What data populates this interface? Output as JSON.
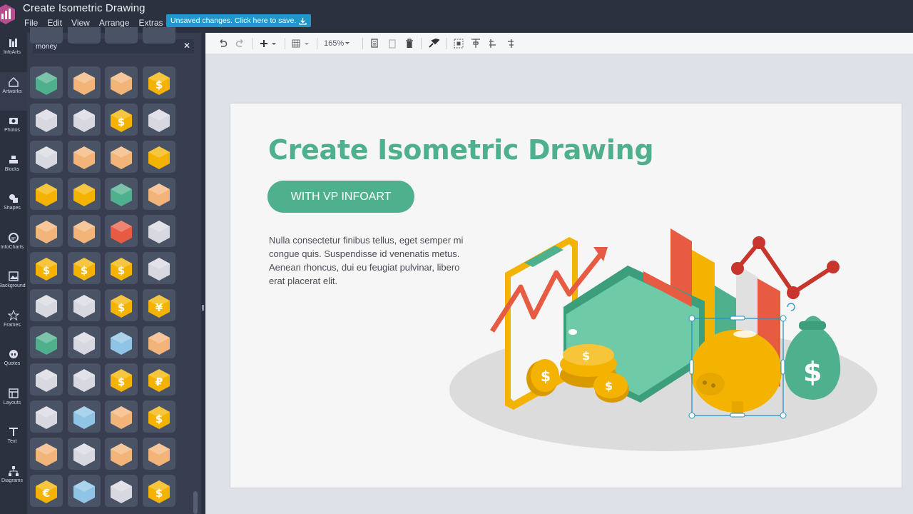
{
  "app": {
    "title": "Create Isometric Drawing",
    "menu": [
      "File",
      "Edit",
      "View",
      "Arrange",
      "Extras"
    ],
    "unsaved_label": "Unsaved changes. Click here to save."
  },
  "leftbar": {
    "tools": [
      {
        "label": "InfoArts",
        "icon": "infoarts-icon"
      },
      {
        "label": "Artworks",
        "icon": "artworks-icon"
      },
      {
        "label": "Photos",
        "icon": "camera-icon"
      },
      {
        "label": "Blocks",
        "icon": "blocks-icon"
      },
      {
        "label": "Shapes",
        "icon": "shapes-icon"
      },
      {
        "label": "InfoCharts",
        "icon": "infocharts-icon"
      },
      {
        "label": "Background",
        "icon": "background-icon"
      },
      {
        "label": "Frames",
        "icon": "frames-icon"
      },
      {
        "label": "Quotes",
        "icon": "quotes-icon"
      },
      {
        "label": "Layouts",
        "icon": "layouts-icon"
      },
      {
        "label": "Text",
        "icon": "text-icon"
      },
      {
        "label": "Diagrams",
        "icon": "diagrams-icon"
      }
    ]
  },
  "panel": {
    "search_value": "money",
    "clear_icon": "close-icon",
    "items": [
      "cash-stack",
      "pallet",
      "pallet-stack",
      "dollar-sign",
      "shelf",
      "shelf-boxes",
      "coin-stack",
      "grid-shelf",
      "rack",
      "wood-pallet",
      "pallet",
      "gold-bars",
      "gold-bricks",
      "piggy-bank",
      "wallet",
      "boxes",
      "crate",
      "box-stack",
      "credit-cards",
      "rack-long",
      "coin",
      "dollar-coin",
      "coin-pile",
      "rack-grid",
      "shelf-tall",
      "shelf-boxes",
      "coin-stack-hand",
      "yen-sign",
      "wallet-green",
      "scale-box",
      "airplane",
      "box-row",
      "cabinet",
      "scale",
      "money-bag",
      "ruble-sign",
      "tall-rack",
      "airplane",
      "box-pile",
      "coin-tower",
      "box-stack",
      "rack-boxes",
      "pallet",
      "boxes",
      "euro-sign",
      "bus",
      "shelf",
      "coin-stack"
    ]
  },
  "toolbar": {
    "zoom": "165%",
    "buttons": [
      "undo-icon",
      "redo-icon",
      "add-icon",
      "table-icon",
      "copy-icon",
      "paste-icon",
      "delete-icon",
      "format-icon",
      "select-icon",
      "align-icon",
      "distribute-icon"
    ]
  },
  "page": {
    "headline": "Create Isometric Drawing",
    "pill_label": "WITH VP INFOART",
    "body_lines": [
      "Nulla consectetur finibus tellus, eget semper mi",
      "congue quis. Suspendisse id venenatis metus.",
      "Aenean rhoncus, dui eu feugiat pulvinar, libero",
      "erat placerat elit."
    ]
  },
  "colors": {
    "brand_green": "#4fb08e",
    "topbar": "#2c3140",
    "panel": "#383e50",
    "save_blue": "#2196c9",
    "gold": "#f5b301",
    "red": "#e85b43"
  }
}
